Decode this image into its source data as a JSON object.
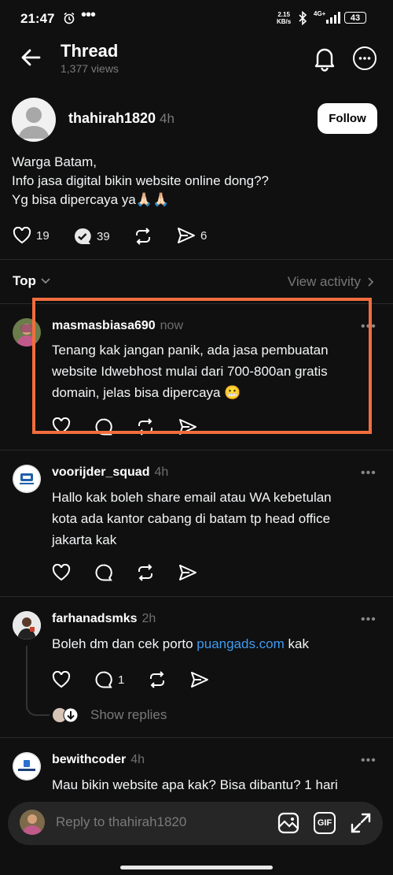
{
  "status_bar": {
    "time": "21:47",
    "speed_value": "2.15",
    "speed_unit": "KB/s",
    "network": "4G+",
    "battery": "43"
  },
  "header": {
    "title": "Thread",
    "views": "1,377 views"
  },
  "post": {
    "username": "thahirah1820",
    "time": "4h",
    "follow_label": "Follow",
    "lines": [
      "Warga Batam,",
      "Info jasa digital bikin website online dong??",
      "Yg bisa dipercaya ya🙏🏻🙏🏻"
    ],
    "likes": "19",
    "replies": "39",
    "shares": "6"
  },
  "sort": {
    "label": "Top",
    "view_activity": "View activity"
  },
  "comments": [
    {
      "username": "masmasbiasa690",
      "time": "now",
      "lines": [
        "Tenang kak jangan panik, ada jasa pembuatan",
        "website Idwebhost mulai dari 700-800an gratis",
        "domain, jelas bisa dipercaya 😬"
      ]
    },
    {
      "username": "voorijder_squad",
      "time": "4h",
      "lines": [
        "Hallo kak boleh share email atau WA kebetulan",
        "kota ada kantor cabang di batam tp head office",
        "jakarta kak"
      ]
    },
    {
      "username": "farhanadsmks",
      "time": "2h",
      "text_before": "Boleh dm dan cek porto ",
      "link": "puangads.com",
      "text_after": " kak",
      "reply_count": "1",
      "show_replies": "Show replies"
    },
    {
      "username": "bewithcoder",
      "time": "4h",
      "lines": [
        "Mau bikin website apa kak? Bisa dibantu? 1 hari"
      ]
    }
  ],
  "reply_bar": {
    "placeholder": "Reply to thahirah1820",
    "gif_label": "GIF"
  },
  "colors": {
    "background": "#101010",
    "highlight_border": "#f26d3d",
    "link": "#3f9bf2"
  }
}
